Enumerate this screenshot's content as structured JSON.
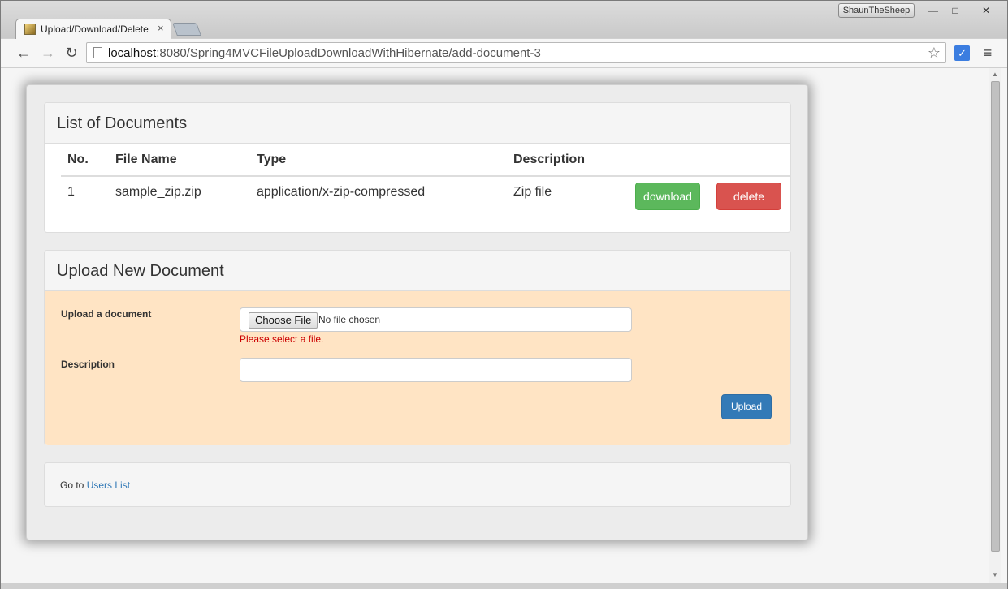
{
  "window": {
    "user": "ShaunTheSheep",
    "min_icon": "—",
    "max_icon": "□",
    "close_icon": "✕"
  },
  "tab": {
    "title": "Upload/Download/Delete",
    "close": "×"
  },
  "toolbar": {
    "back": "←",
    "forward": "→",
    "reload": "↻",
    "url_host": "localhost",
    "url_path": ":8080/Spring4MVCFileUploadDownloadWithHibernate/add-document-3",
    "star": "☆",
    "menu": "≡"
  },
  "documents_panel": {
    "title": "List of Documents",
    "columns": [
      "No.",
      "File Name",
      "Type",
      "Description"
    ],
    "rows": [
      {
        "no": "1",
        "file_name": "sample_zip.zip",
        "type": "application/x-zip-compressed",
        "description": "Zip file",
        "download_label": "download",
        "delete_label": "delete"
      }
    ]
  },
  "upload_panel": {
    "title": "Upload New Document",
    "file_label": "Upload a document",
    "choose_file": "Choose File",
    "file_status": "No file chosen",
    "error": "Please select a file.",
    "description_label": "Description",
    "description_value": "",
    "upload_label": "Upload"
  },
  "footer": {
    "prefix": "Go to",
    "link": "Users List"
  },
  "colors": {
    "download": "#5cb85c",
    "delete": "#d9534f",
    "upload": "#337ab7",
    "form_background": "#ffe4c4",
    "error": "#cc0000"
  }
}
